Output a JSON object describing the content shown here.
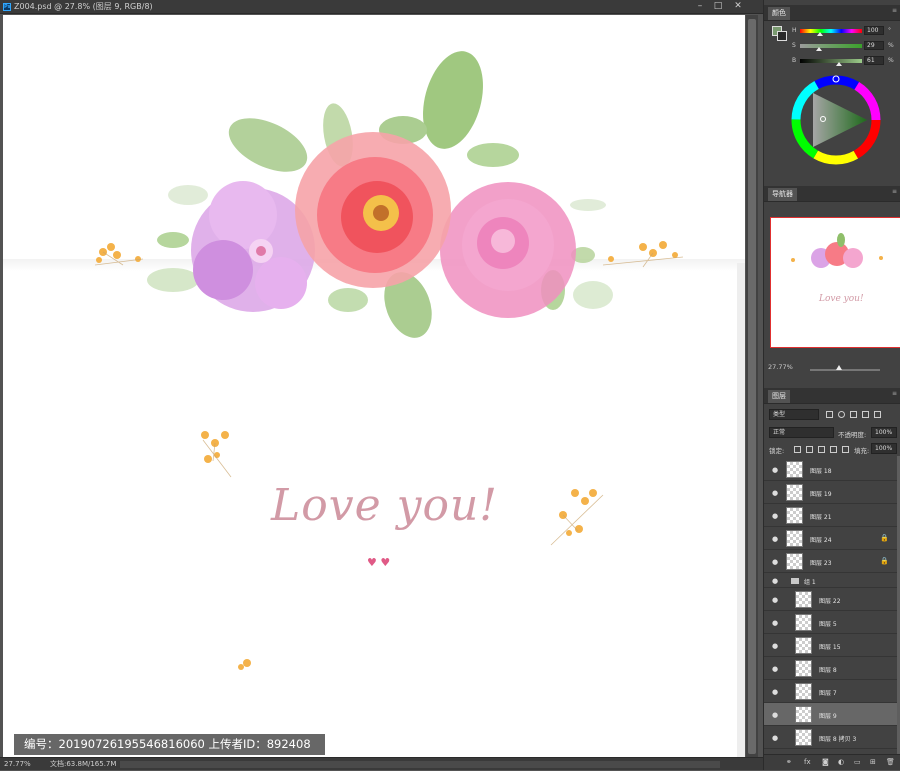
{
  "document": {
    "tab_title": "Z004.psd @ 27.8% (图层 9, RGB/8)",
    "ps_badge": "Ps",
    "minimize": "–",
    "restore": "□",
    "close": "✕",
    "canvas_text": "Love you!",
    "hearts": "♥ ♥"
  },
  "status_bar": {
    "zoom": "27.77%",
    "doc_size": "文档:63.8M/165.7M"
  },
  "watermark_caption": "编号：20190726195546816060 上传者ID：892408",
  "panels": {
    "color": {
      "tab": "颜色",
      "sliders": [
        {
          "label": "H",
          "value": "100",
          "unit": "°"
        },
        {
          "label": "S",
          "value": "29",
          "unit": "%"
        },
        {
          "label": "B",
          "value": "61",
          "unit": "%"
        }
      ]
    },
    "navigator": {
      "tab": "导航器",
      "zoom": "27.77%",
      "preview_text": "Love you!"
    },
    "layers": {
      "tab": "图层",
      "filter_kind": "类型",
      "blend_mode": "正常",
      "opacity_label": "不透明度:",
      "opacity": "100%",
      "lock_label": "锁定:",
      "fill_label": "填充:",
      "fill": "100%",
      "items": [
        {
          "name": "图层 18",
          "indent": 0,
          "locked": false,
          "selected": false,
          "group": false
        },
        {
          "name": "图层 19",
          "indent": 0,
          "locked": false,
          "selected": false,
          "group": false
        },
        {
          "name": "图层 21",
          "indent": 0,
          "locked": false,
          "selected": false,
          "group": false
        },
        {
          "name": "图层 24",
          "indent": 0,
          "locked": true,
          "selected": false,
          "group": false
        },
        {
          "name": "图层 23",
          "indent": 0,
          "locked": true,
          "selected": false,
          "group": false
        },
        {
          "name": "组 1",
          "indent": 0,
          "locked": false,
          "selected": false,
          "group": true
        },
        {
          "name": "图层 22",
          "indent": 1,
          "locked": false,
          "selected": false,
          "group": false
        },
        {
          "name": "图层 5",
          "indent": 1,
          "locked": false,
          "selected": false,
          "group": false
        },
        {
          "name": "图层 15",
          "indent": 1,
          "locked": false,
          "selected": false,
          "group": false
        },
        {
          "name": "图层 8",
          "indent": 1,
          "locked": false,
          "selected": false,
          "group": false
        },
        {
          "name": "图层 7",
          "indent": 1,
          "locked": false,
          "selected": false,
          "group": false
        },
        {
          "name": "图层 9",
          "indent": 1,
          "locked": false,
          "selected": true,
          "group": false
        },
        {
          "name": "图层 8 拷贝 3",
          "indent": 1,
          "locked": false,
          "selected": false,
          "group": false
        }
      ],
      "footer_icons": [
        "link-icon",
        "fx-icon",
        "mask-icon",
        "adjustment-icon",
        "folder-icon",
        "new-layer-icon",
        "trash-icon"
      ]
    }
  },
  "colors": {
    "accent": "#31a8ff",
    "foreground_swatch": "#7a9a70",
    "navigator_frame": "#e03030",
    "script_text": "#d29aa6",
    "heart": "#e05a86"
  }
}
